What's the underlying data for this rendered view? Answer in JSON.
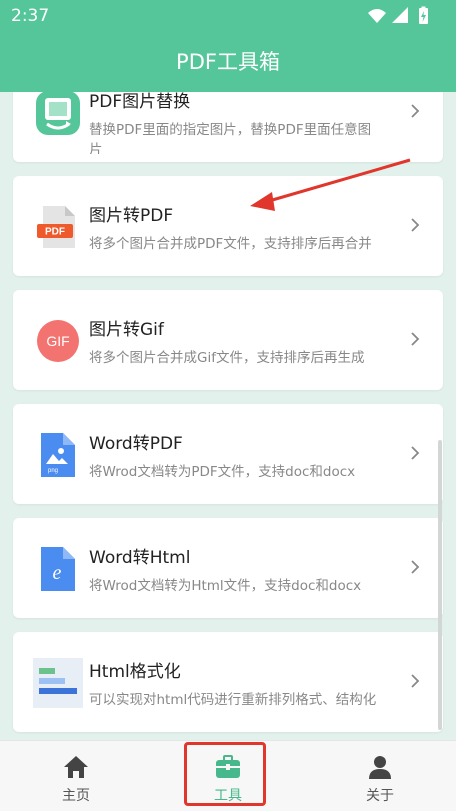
{
  "status_bar": {
    "time": "2:37"
  },
  "app_bar": {
    "title": "PDF工具箱"
  },
  "tools": [
    {
      "title": "PDF图片替换",
      "desc": "替换PDF里面的指定图片，替换PDF里面任意图片",
      "icon": "image-replace-icon"
    },
    {
      "title": "图片转PDF",
      "desc": "将多个图片合并成PDF文件，支持排序后再合并",
      "icon": "pdf-file-icon",
      "icon_label": "PDF"
    },
    {
      "title": "图片转Gif",
      "desc": "将多个图片合并成Gif文件，支持排序后再生成",
      "icon": "gif-icon",
      "icon_label": "GIF"
    },
    {
      "title": "Word转PDF",
      "desc": "将Wrod文档转为PDF文件，支持doc和docx",
      "icon": "png-file-icon",
      "icon_label": "png"
    },
    {
      "title": "Word转Html",
      "desc": "将Wrod文档转为Html文件，支持doc和docx",
      "icon": "ie-file-icon",
      "icon_label": "e"
    },
    {
      "title": "Html格式化",
      "desc": "可以实现对html代码进行重新排列格式、结构化",
      "icon": "format-layout-icon"
    }
  ],
  "bottom_nav": {
    "items": [
      {
        "label": "主页",
        "icon": "home-icon",
        "active": false
      },
      {
        "label": "工具",
        "icon": "toolbox-icon",
        "active": true
      },
      {
        "label": "关于",
        "icon": "person-icon",
        "active": false
      }
    ]
  },
  "colors": {
    "accent": "#55c69a",
    "annotation": "#e0362c"
  }
}
